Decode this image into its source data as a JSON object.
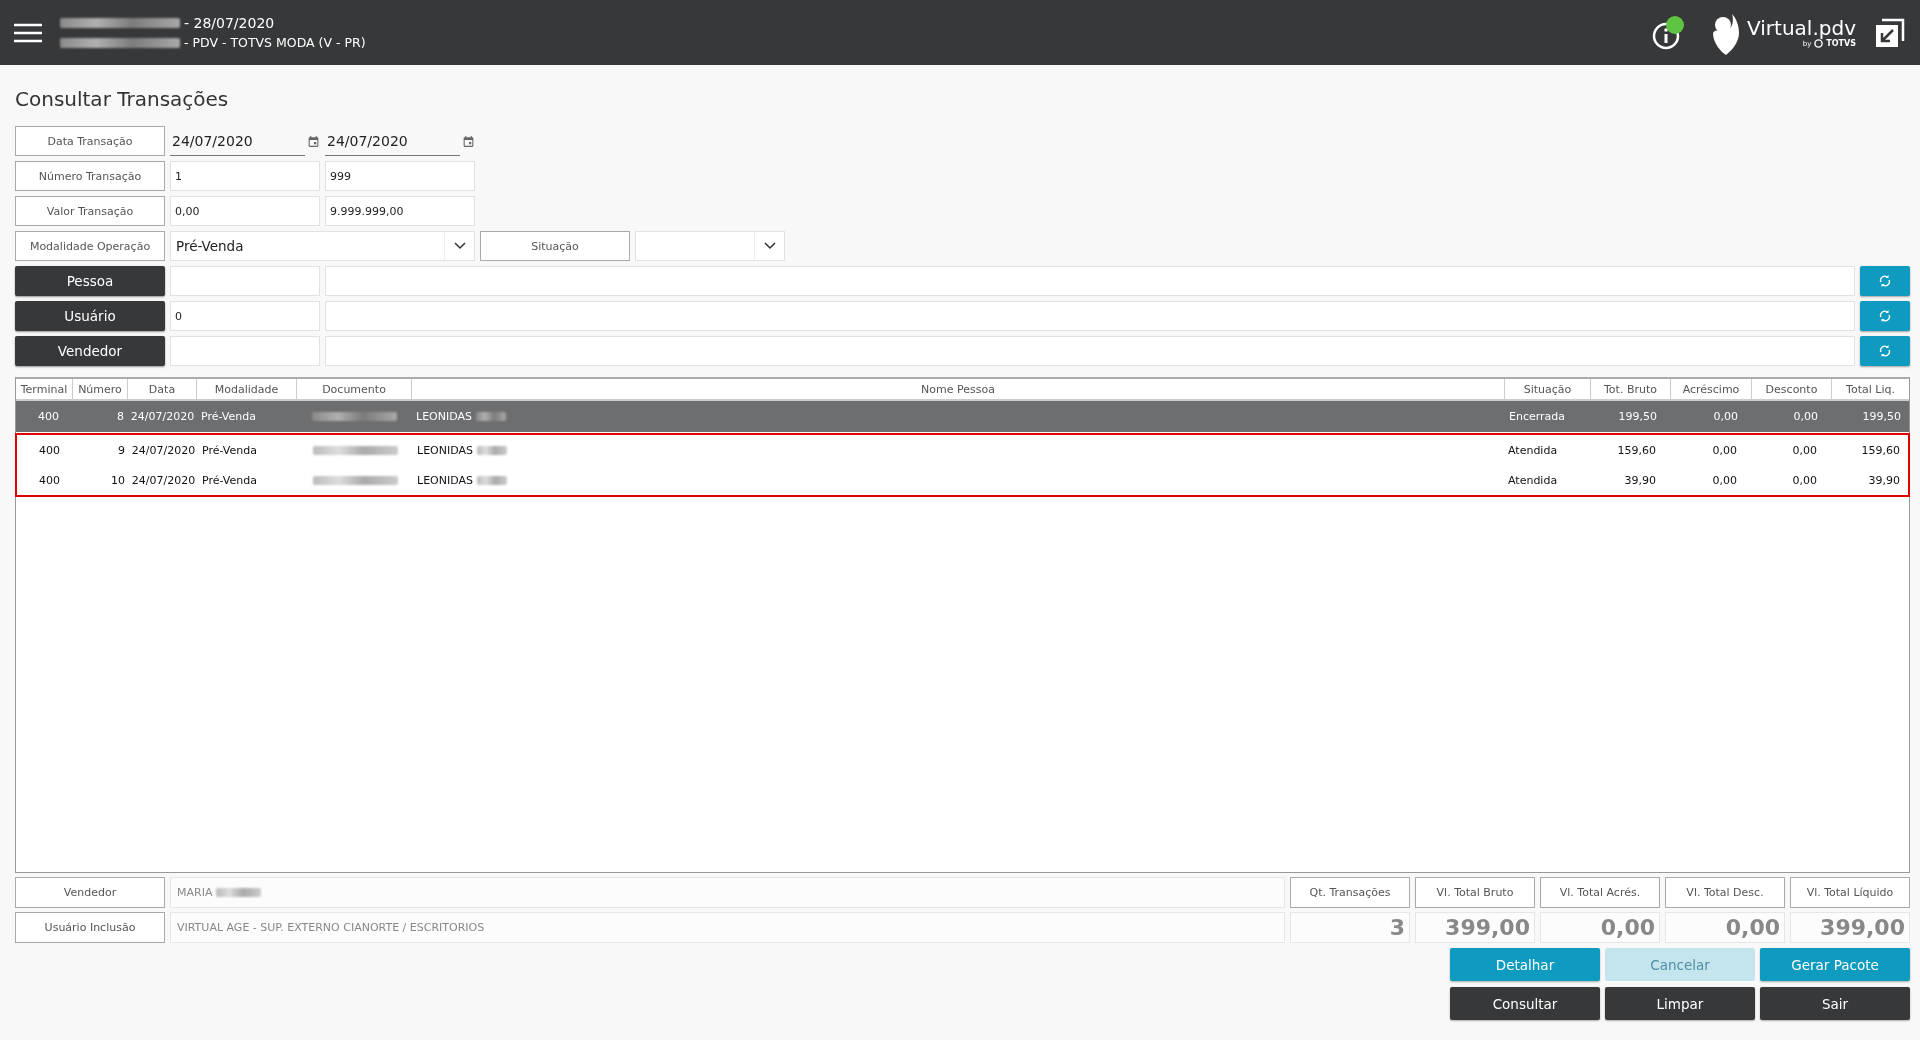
{
  "header": {
    "line_1": {
      "prefix_blurred": true,
      "text": "- 28/07/2020"
    },
    "line_2": {
      "prefix_blurred": true,
      "text": "- PDV - TOTVS MODA (V - PR)"
    },
    "status_online": true,
    "logo": {
      "name": "Virtual.pdv",
      "by": "by",
      "brand": "TOTVS"
    }
  },
  "page_title": "Consultar Transações",
  "filters": [
    {
      "kind": "date_range",
      "label": "Data Transação",
      "from": "24/07/2020",
      "to": "24/07/2020"
    },
    {
      "kind": "range",
      "label": "Número Transação",
      "from": "1",
      "to": "999"
    },
    {
      "kind": "range",
      "label": "Valor Transação",
      "from": "0,00",
      "to": "9.999.999,00"
    },
    {
      "kind": "selects",
      "label": "Modalidade Operação",
      "value": "Pré-Venda",
      "second_label": "Situação"
    },
    {
      "kind": "lookup",
      "label": "Pessoa"
    },
    {
      "kind": "lookup",
      "label": "Usuário",
      "code": "0"
    },
    {
      "kind": "lookup",
      "label": "Vendedor"
    }
  ],
  "table": {
    "columns": [
      "Terminal",
      "Número",
      "Data",
      "Modalidade",
      "Documento",
      "Nome Pessoa",
      "Situação",
      "Tot. Bruto",
      "Acréscimo",
      "Desconto",
      "Total Liq."
    ],
    "rows": [
      {
        "selected": true,
        "highlighted": false,
        "terminal": "400",
        "numero": "8",
        "data": "24/07/2020",
        "modalidade": "Pré-Venda",
        "documento_blurred": true,
        "nome": "LEONIDAS",
        "nome_blurred": true,
        "situacao": "Encerrada",
        "bruto": "199,50",
        "acrescimo": "0,00",
        "desconto": "0,00",
        "liquido": "199,50"
      },
      {
        "selected": false,
        "highlighted": true,
        "terminal": "400",
        "numero": "9",
        "data": "24/07/2020",
        "modalidade": "Pré-Venda",
        "documento_blurred": true,
        "nome": "LEONIDAS",
        "nome_blurred": true,
        "situacao": "Atendida",
        "bruto": "159,60",
        "acrescimo": "0,00",
        "desconto": "0,00",
        "liquido": "159,60"
      },
      {
        "selected": false,
        "highlighted": true,
        "terminal": "400",
        "numero": "10",
        "data": "24/07/2020",
        "modalidade": "Pré-Venda",
        "documento_blurred": true,
        "nome": "LEONIDAS",
        "nome_blurred": true,
        "situacao": "Atendida",
        "bruto": "39,90",
        "acrescimo": "0,00",
        "desconto": "0,00",
        "liquido": "39,90"
      }
    ]
  },
  "details": [
    {
      "label": "Vendedor",
      "value": "MARIA",
      "value_blurred": true
    },
    {
      "label": "Usuário Inclusão",
      "value": "VIRTUAL AGE - SUP. EXTERNO CIANORTE / ESCRITORIOS",
      "value_blurred": false
    }
  ],
  "totals": [
    {
      "label": "Qt. Transações",
      "value": "3"
    },
    {
      "label": "Vl. Total Bruto",
      "value": "399,00"
    },
    {
      "label": "Vl. Total Acrés.",
      "value": "0,00"
    },
    {
      "label": "Vl. Total Desc.",
      "value": "0,00"
    },
    {
      "label": "Vl. Total Líquido",
      "value": "399,00"
    }
  ],
  "buttons": [
    {
      "label": "Detalhar",
      "kind": "primary",
      "disabled": false
    },
    {
      "label": "Cancelar",
      "kind": "primary",
      "disabled": true
    },
    {
      "label": "Gerar Pacote",
      "kind": "primary",
      "disabled": false
    },
    {
      "label": "Consultar",
      "kind": "dark",
      "disabled": false
    },
    {
      "label": "Limpar",
      "kind": "dark",
      "disabled": false
    },
    {
      "label": "Sair",
      "kind": "dark",
      "disabled": false
    }
  ]
}
